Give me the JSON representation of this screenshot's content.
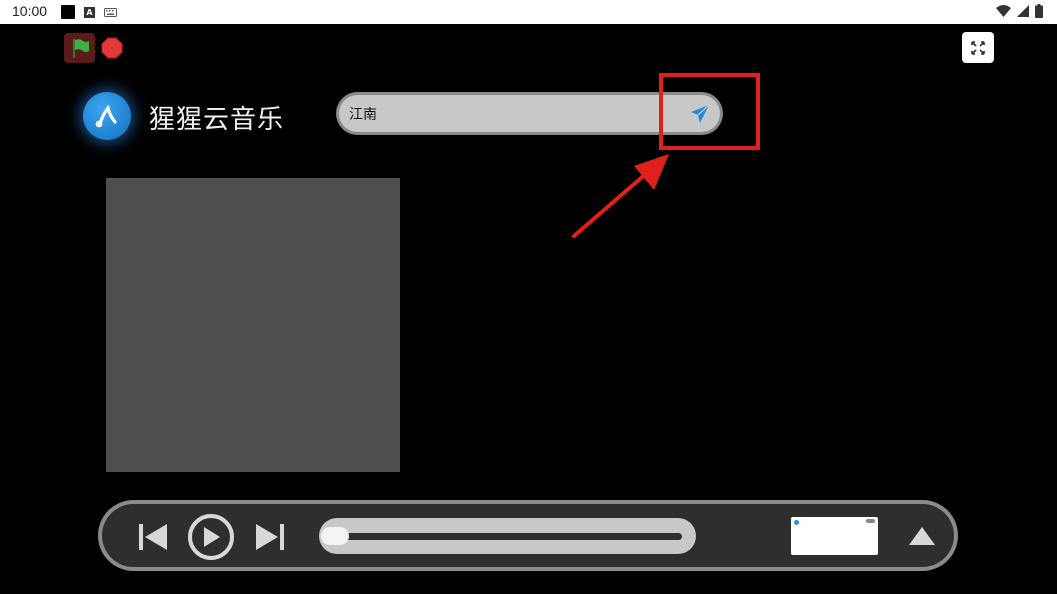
{
  "status_bar": {
    "time": "10:00",
    "a_badge": "A"
  },
  "stage": {
    "flag_icon": "green-flag-icon",
    "stop_icon": "stop-icon",
    "fullscreen_icon": "fullscreen-icon"
  },
  "app": {
    "title": "猩猩云音乐",
    "logo_icon": "music-note-icon"
  },
  "search": {
    "value": "江南",
    "send_icon": "send-icon"
  },
  "player": {
    "progress": 0.0,
    "prev_icon": "skip-previous-icon",
    "play_icon": "play-icon",
    "next_icon": "skip-next-icon",
    "expand_icon": "triangle-up-icon"
  },
  "colors": {
    "background": "#000000",
    "annotation_red": "#e0201c",
    "flag_green": "#3cb043",
    "stop_red": "#e03a3a",
    "accent_blue": "#1f8ae0",
    "cover_gray": "#4e4e4e"
  }
}
